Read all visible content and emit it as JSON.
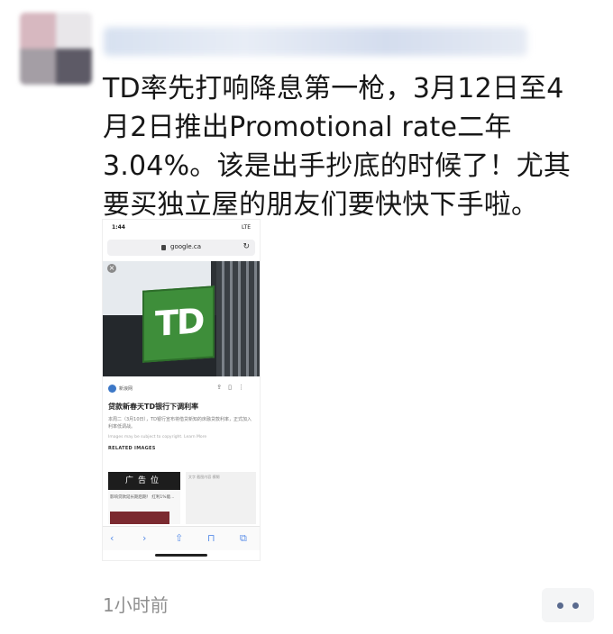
{
  "post": {
    "text": "TD率先打响降息第一枪，3月12日至4\n月2日推出Promotional rate二年\n3.04%。该是出手抄底的时候了！尤其\n要买独立屋的朋友们要快快下手啦。",
    "time": "1小时前"
  },
  "screenshot": {
    "status_time": "1:44",
    "status_right": "LTE",
    "url": "google.ca",
    "logo_text": "TD",
    "source_name": "新浪网",
    "article_title": "贷款新春天TD银行下调利率",
    "article_desc": "本周二（3月10日），TD银行宣布将借贷新知的床融贷款利率，正式加入利率低调战。",
    "copyright": "Images may be subject to copyright. Learn More",
    "related_label": "RELATED IMAGES",
    "ad_label": "广告位",
    "thumb1_text": "影响贷款延长期后期！ 红利1%能...",
    "thumb2_text": "文字 截图内容 模糊"
  },
  "colors": {
    "td_green": "#3e8e3a",
    "link_blue": "#5a8ee8",
    "more_dots": "#596a8e"
  }
}
